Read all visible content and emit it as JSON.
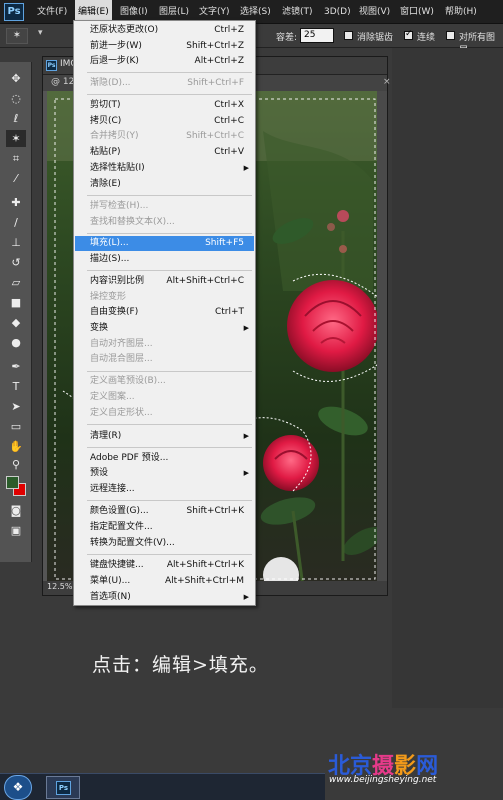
{
  "app": {
    "logo": "Ps",
    "menubar": [
      "文件(F)",
      "编辑(E)",
      "图像(I)",
      "图层(L)",
      "文字(Y)",
      "选择(S)",
      "滤镜(T)",
      "3D(D)",
      "视图(V)",
      "窗口(W)",
      "帮助(H)"
    ]
  },
  "options_bar": {
    "tolerance_label": "容差:",
    "tolerance_value": "25",
    "antialias_label": "消除锯齿",
    "contiguous_label": "连续",
    "all_layers_label": "对所有图层"
  },
  "document": {
    "title": "IMG",
    "tab_title": "@ 12.5%(RGB/8#) *",
    "tab_close": "×",
    "zoom": "12.5%"
  },
  "edit_menu": {
    "items": [
      {
        "label": "还原状态更改(O)",
        "shortcut": "Ctrl+Z",
        "disabled": false
      },
      {
        "label": "前进一步(W)",
        "shortcut": "Shift+Ctrl+Z",
        "disabled": false
      },
      {
        "label": "后退一步(K)",
        "shortcut": "Alt+Ctrl+Z",
        "disabled": false
      },
      {
        "label": "渐隐(D)...",
        "shortcut": "Shift+Ctrl+F",
        "disabled": true
      },
      {
        "label": "剪切(T)",
        "shortcut": "Ctrl+X",
        "disabled": false
      },
      {
        "label": "拷贝(C)",
        "shortcut": "Ctrl+C",
        "disabled": false
      },
      {
        "label": "合并拷贝(Y)",
        "shortcut": "Shift+Ctrl+C",
        "disabled": true
      },
      {
        "label": "粘贴(P)",
        "shortcut": "Ctrl+V",
        "disabled": false
      },
      {
        "label": "选择性粘贴(I)",
        "shortcut": "",
        "submenu": true,
        "disabled": false
      },
      {
        "label": "清除(E)",
        "shortcut": "",
        "disabled": false
      },
      {
        "label": "拼写检查(H)...",
        "shortcut": "",
        "disabled": true
      },
      {
        "label": "查找和替换文本(X)...",
        "shortcut": "",
        "disabled": true
      },
      {
        "label": "填充(L)...",
        "shortcut": "Shift+F5",
        "disabled": false,
        "highlighted": true
      },
      {
        "label": "描边(S)...",
        "shortcut": "",
        "disabled": false
      },
      {
        "label": "内容识别比例",
        "shortcut": "Alt+Shift+Ctrl+C",
        "disabled": false
      },
      {
        "label": "操控变形",
        "shortcut": "",
        "disabled": true
      },
      {
        "label": "自由变换(F)",
        "shortcut": "Ctrl+T",
        "disabled": false
      },
      {
        "label": "变换",
        "shortcut": "",
        "submenu": true,
        "disabled": false
      },
      {
        "label": "自动对齐图层...",
        "shortcut": "",
        "disabled": true
      },
      {
        "label": "自动混合图层...",
        "shortcut": "",
        "disabled": true
      },
      {
        "label": "定义画笔预设(B)...",
        "shortcut": "",
        "disabled": true
      },
      {
        "label": "定义图案...",
        "shortcut": "",
        "disabled": true
      },
      {
        "label": "定义自定形状...",
        "shortcut": "",
        "disabled": true
      },
      {
        "label": "清理(R)",
        "shortcut": "",
        "submenu": true,
        "disabled": false
      },
      {
        "label": "Adobe PDF 预设...",
        "shortcut": "",
        "disabled": false
      },
      {
        "label": "预设",
        "shortcut": "",
        "submenu": true,
        "disabled": false
      },
      {
        "label": "远程连接...",
        "shortcut": "",
        "disabled": false
      },
      {
        "label": "颜色设置(G)...",
        "shortcut": "Shift+Ctrl+K",
        "disabled": false
      },
      {
        "label": "指定配置文件...",
        "shortcut": "",
        "disabled": false
      },
      {
        "label": "转换为配置文件(V)...",
        "shortcut": "",
        "disabled": false
      },
      {
        "label": "键盘快捷键...",
        "shortcut": "Alt+Shift+Ctrl+K",
        "disabled": false
      },
      {
        "label": "菜单(U)...",
        "shortcut": "Alt+Shift+Ctrl+M",
        "disabled": false
      },
      {
        "label": "首选项(N)",
        "shortcut": "",
        "submenu": true,
        "disabled": false
      }
    ]
  },
  "caption": "点击：编辑>填充。",
  "watermark": {
    "text": "北京摄影网",
    "url": "www.beijingsheying.net"
  },
  "taskbar": {
    "start_icon": "❖",
    "ps_label": "Ps"
  },
  "colors": {
    "highlight": "#3c8ce6",
    "foreground_swatch": "#2b5c2b",
    "background_swatch": "#e00000"
  }
}
